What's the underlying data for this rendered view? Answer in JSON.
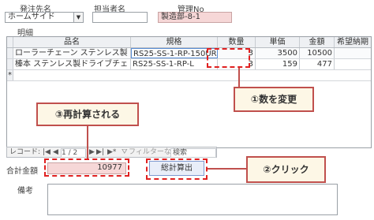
{
  "header": {
    "supplier_label": "発注先名",
    "supplier_value": "ホームサイド",
    "person_label": "担当者名",
    "person_value": "",
    "mgmt_label": "管理No",
    "mgmt_value": "製造部-8-1"
  },
  "detail": {
    "section_label": "明細",
    "columns": [
      "品名",
      "規格",
      "数量",
      "単価",
      "金額",
      "希望納期"
    ],
    "rows": [
      {
        "selector": "",
        "name": "ローラーチェーン ステンレス製",
        "spec": "RS25-SS-1-RP-150UR",
        "qty": "3",
        "price": "3500",
        "amount": "10500",
        "date": ""
      },
      {
        "selector": "",
        "name": "榛本 ステンレス製ドライブチェ",
        "spec": "RS25-SS-1-RP-L",
        "qty": "3",
        "price": "159",
        "amount": "477",
        "date": ""
      }
    ],
    "new_row_marker": "*"
  },
  "nav": {
    "record_label": "レコード:",
    "first": "|◀",
    "prev": "◀",
    "position": "1 / 2",
    "next": "▶",
    "last": "▶|",
    "new": "▶*",
    "filter": "フィルターなし",
    "search": "検索"
  },
  "total": {
    "label": "合計金額",
    "value": "10977"
  },
  "calc_button": "総計算出",
  "remarks_label": "備考",
  "annotations": {
    "step1": "①数を変更",
    "step2": "②クリック",
    "step3": "③再計算される"
  },
  "colors": {
    "callout_border": "#c0504d",
    "callout_fill": "#fdf7e6",
    "dash": "#e02020",
    "pink_field": "#f6d7d7"
  }
}
